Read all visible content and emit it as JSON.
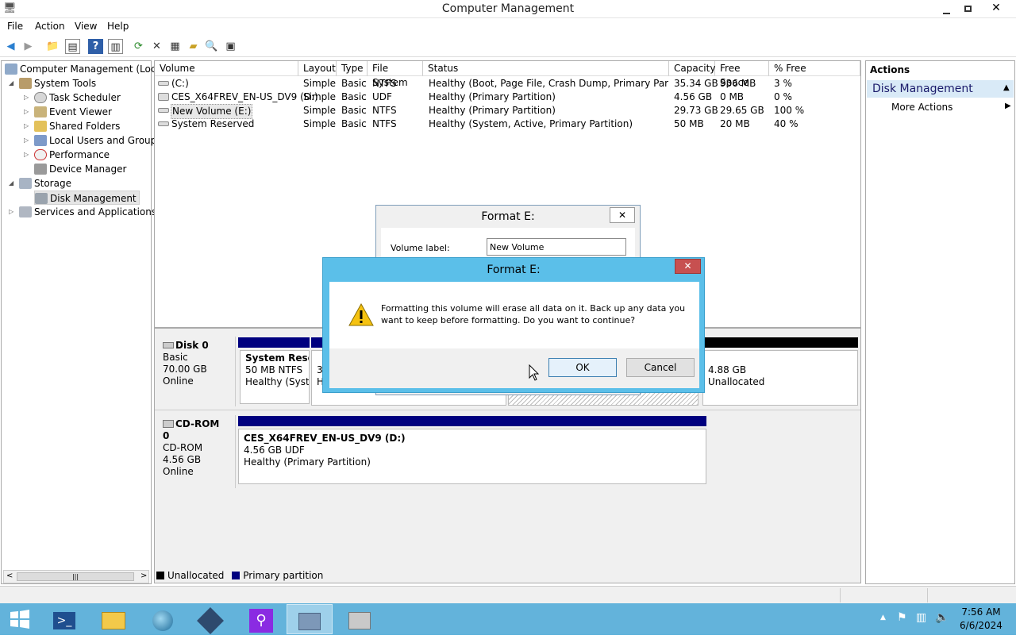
{
  "window": {
    "title": "Computer Management"
  },
  "menu": [
    "File",
    "Action",
    "View",
    "Help"
  ],
  "tree": {
    "root": "Computer Management (Local",
    "system_tools": "System Tools",
    "task_scheduler": "Task Scheduler",
    "event_viewer": "Event Viewer",
    "shared_folders": "Shared Folders",
    "local_users": "Local Users and Groups",
    "performance": "Performance",
    "device_manager": "Device Manager",
    "storage": "Storage",
    "disk_management": "Disk Management",
    "services": "Services and Applications"
  },
  "volumes": {
    "headers": [
      "Volume",
      "Layout",
      "Type",
      "File System",
      "Status",
      "Capacity",
      "Free Space",
      "% Free"
    ],
    "rows": [
      [
        "(C:)",
        "Simple",
        "Basic",
        "NTFS",
        "Healthy (Boot, Page File, Crash Dump, Primary Partition)",
        "35.34 GB",
        "936 MB",
        "3 %"
      ],
      [
        "CES_X64FREV_EN-US_DV9 (D:)",
        "Simple",
        "Basic",
        "UDF",
        "Healthy (Primary Partition)",
        "4.56 GB",
        "0 MB",
        "0 %"
      ],
      [
        "New Volume (E:)",
        "Simple",
        "Basic",
        "NTFS",
        "Healthy (Primary Partition)",
        "29.73 GB",
        "29.65 GB",
        "100 %"
      ],
      [
        "System Reserved",
        "Simple",
        "Basic",
        "NTFS",
        "Healthy (System, Active, Primary Partition)",
        "50 MB",
        "20 MB",
        "40 %"
      ]
    ]
  },
  "disk0": {
    "name": "Disk 0",
    "type": "Basic",
    "size": "70.00 GB",
    "state": "Online",
    "p1_name": "System Reser",
    "p1_size": "50 MB NTFS",
    "p1_status": "Healthy (Syste",
    "p2_frag": "3",
    "p2_frag2": "H",
    "unalloc_size": "4.88 GB",
    "unalloc_label": "Unallocated"
  },
  "cdrom0": {
    "name": "CD-ROM 0",
    "type": "CD-ROM",
    "size": "4.56 GB",
    "state": "Online",
    "p_name": "CES_X64FREV_EN-US_DV9  (D:)",
    "p_size": "4.56 GB UDF",
    "p_status": "Healthy (Primary Partition)"
  },
  "legend": {
    "unallocated": "Unallocated",
    "primary": "Primary partition"
  },
  "actions": {
    "header": "Actions",
    "section": "Disk Management",
    "more": "More Actions"
  },
  "format_dialog": {
    "title": "Format E:",
    "label": "Volume label:",
    "value": "New Volume"
  },
  "confirm_dialog": {
    "title": "Format E:",
    "message_line1": "Formatting this volume will erase all data on it. Back up any data you",
    "message_line2": "want to keep before formatting. Do you want to continue?",
    "ok": "OK",
    "cancel": "Cancel"
  },
  "clock": {
    "time": "7:56 AM",
    "date": "6/6/2024"
  },
  "colors": {
    "primary_partition": "#00007f",
    "unallocated": "#000000",
    "taskbar": "#63b3db",
    "dialog_border": "#5bbfe9"
  }
}
